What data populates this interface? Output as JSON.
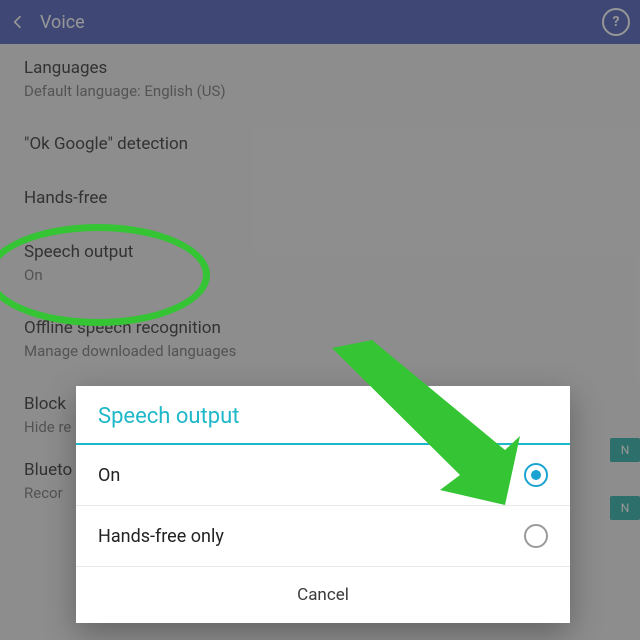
{
  "appbar": {
    "title": "Voice"
  },
  "settings": {
    "languages": {
      "title": "Languages",
      "subtitle": "Default language: English (US)"
    },
    "okGoogle": {
      "title": "\"Ok Google\" detection"
    },
    "handsFree": {
      "title": "Hands-free"
    },
    "speechOutput": {
      "title": "Speech output",
      "subtitle": "On"
    },
    "offline": {
      "title": "Offline speech recognition",
      "subtitle": "Manage downloaded languages"
    },
    "block": {
      "title": "Block",
      "subtitle": "Hide re",
      "badge": "N"
    },
    "bluetooth": {
      "title": "Blueto",
      "subtitle": "Recor",
      "badge": "N"
    }
  },
  "dialog": {
    "title": "Speech output",
    "options": [
      {
        "label": "On",
        "selected": true
      },
      {
        "label": "Hands-free only",
        "selected": false
      }
    ],
    "cancel": "Cancel"
  }
}
